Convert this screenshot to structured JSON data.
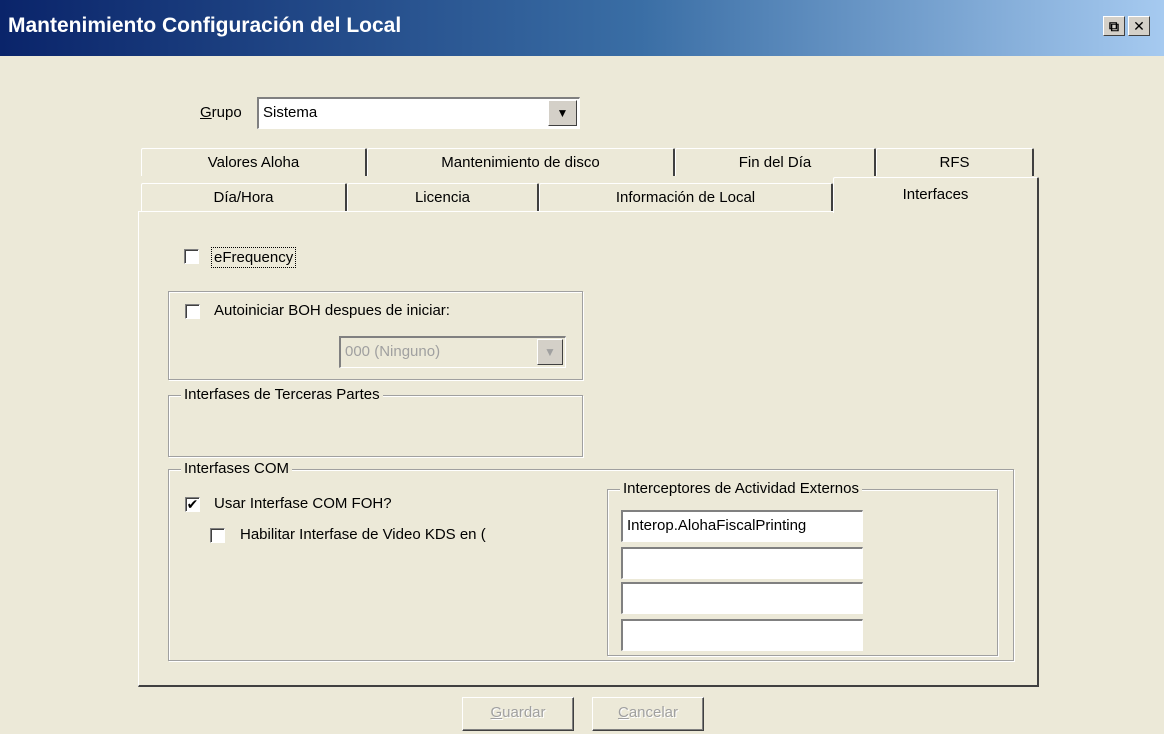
{
  "window": {
    "title": "Mantenimiento Configuración del Local",
    "restore_glyph": "⧉",
    "close_glyph": "✕"
  },
  "grupo": {
    "label": "Grupo",
    "selected": "Sistema"
  },
  "tabs": {
    "row1": [
      "Valores Aloha",
      "Mantenimiento de disco",
      "Fin del Día",
      "RFS"
    ],
    "row2": [
      "Día/Hora",
      "Licencia",
      "Información de Local",
      "Interfaces"
    ],
    "active": "Interfaces"
  },
  "interfaces": {
    "efrequency": {
      "label": "eFrequency",
      "checked": false
    },
    "autoiniciar": {
      "label": "Autoiniciar BOH despues de iniciar:",
      "checked": false,
      "select_value": "000 (Ninguno)"
    },
    "terceras": {
      "legend": "Interfases de Terceras Partes"
    },
    "com": {
      "legend": "Interfases COM",
      "usar_foh": {
        "label": "Usar Interfase COM FOH?",
        "checked": true
      },
      "video_kds": {
        "label": "Habilitar Interfase de Video KDS en (",
        "checked": false
      },
      "interceptores": {
        "legend": "Interceptores de Actividad Externos",
        "values": [
          "Interop.AlohaFiscalPrinting",
          "",
          "",
          ""
        ]
      }
    }
  },
  "buttons": {
    "guardar": "Guardar",
    "cancelar": "Cancelar"
  }
}
